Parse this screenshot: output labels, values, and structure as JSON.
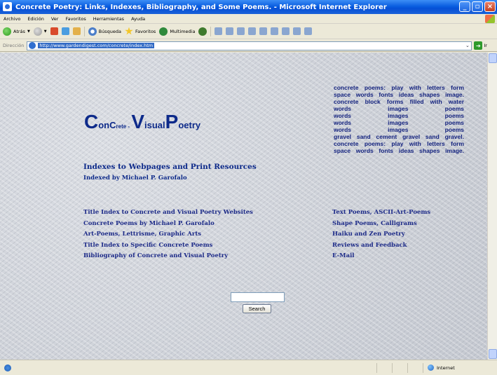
{
  "window": {
    "title": "Concrete Poetry:  Links, Indexes, Bibliography, and Some Poems. - Microsoft Internet Explorer",
    "controls": [
      "_",
      "▫",
      "×"
    ]
  },
  "menu": [
    "Archivo",
    "Edición",
    "Ver",
    "Favoritos",
    "Herramientas",
    "Ayuda"
  ],
  "toolbar": {
    "back_label": "Atrás",
    "search_label": "Búsqueda",
    "favorites_label": "Favoritos",
    "media_label": "Multimedia"
  },
  "address": {
    "label": "Dirección",
    "url": "http://www.gardendigest.com/concrete/index.htm",
    "go_label": "Ir"
  },
  "page": {
    "logo": {
      "c1": "C",
      "on": "on",
      "c2": "C",
      "rete": "rete",
      "dash": " - ",
      "v": "V",
      "isual": "isual",
      "p": "P",
      "oetry": "oetry"
    },
    "concrete_block": {
      "line1": "concrete poems: play with letters form",
      "line2": "space words fonts ideas shapes image.",
      "line3": "concrete block forms  filled with water",
      "rows": [
        [
          "words",
          "images",
          "poems"
        ],
        [
          "words",
          "images",
          "poems"
        ],
        [
          "words",
          "images",
          "poems"
        ],
        [
          "words",
          "images",
          "poems"
        ]
      ],
      "line4": "gravel sand cement gravel sand gravel.",
      "line5": "concrete poems: play with letters form",
      "line6": "space words fonts ideas shapes image."
    },
    "heading": "Indexes to Webpages and Print Resources",
    "subheading": "Indexed by Michael P. Garofalo",
    "links_left": [
      "Title Index to Concrete and Visual Poetry Websites",
      "Concrete Poems by Michael P. Garofalo",
      "Art-Poems, Lettrisme, Graphic Arts",
      "Title Index to Specific Concrete Poems",
      "Bibliography of Concrete and Visual  Poetry"
    ],
    "links_right": [
      "Text Poems, ASCII-Art-Poems",
      "Shape Poems, Calligrams",
      "Haiku and Zen Poetry",
      "Reviews and Feedback",
      "E-Mail"
    ],
    "search": {
      "value": "",
      "button_label": "Search"
    }
  },
  "status": {
    "zone": "Internet"
  }
}
